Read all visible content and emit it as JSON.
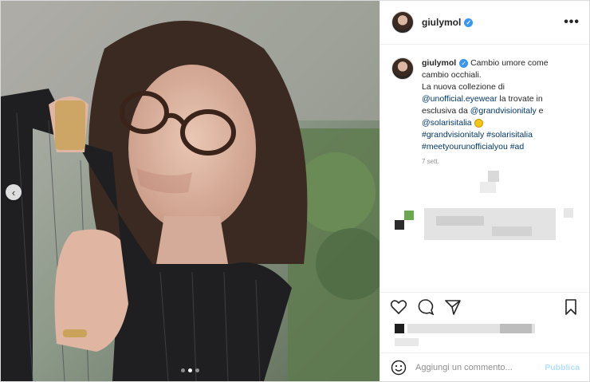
{
  "post": {
    "username": "giulymol",
    "more_label": "•••",
    "caption": {
      "username": "giulymol",
      "line1": "Cambio umore come cambio occhiali.",
      "line2_prefix": "La nuova collezione di ",
      "mention1": "@unofficial.eyewear",
      "line2_mid": " la trovate in esclusiva da ",
      "mention2": "@grandvisionitaly",
      "line2_and": " e ",
      "mention3": "@solarisitalia",
      "hashtags": "#grandvisionitaly #solarisitalia #meetyourunofficialyou #ad"
    },
    "date": "7 sett."
  },
  "comment_box": {
    "placeholder": "Aggiungi un commento...",
    "post_label": "Pubblica"
  },
  "carousel": {
    "current_index": 1,
    "count": 3
  },
  "colors": {
    "link": "#00376b",
    "verified": "#3897f0",
    "post_button_disabled": "#b2dffc"
  },
  "icons": [
    "heart-icon",
    "comment-icon",
    "share-icon",
    "bookmark-icon",
    "emoji-icon",
    "more-icon",
    "verified-icon",
    "chevron-left-icon"
  ]
}
